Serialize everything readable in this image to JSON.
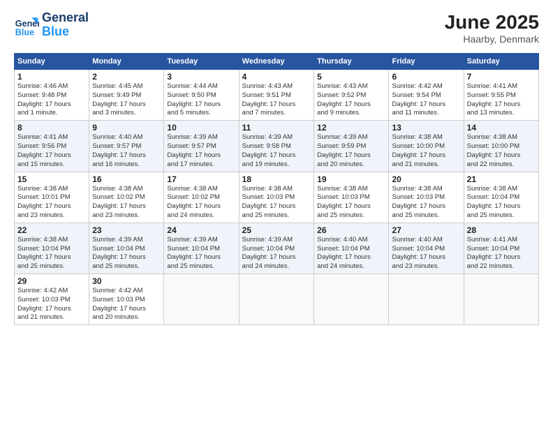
{
  "logo": {
    "line1": "General",
    "line2": "Blue"
  },
  "title": "June 2025",
  "location": "Haarby, Denmark",
  "headers": [
    "Sunday",
    "Monday",
    "Tuesday",
    "Wednesday",
    "Thursday",
    "Friday",
    "Saturday"
  ],
  "weeks": [
    [
      {
        "day": "1",
        "info": "Sunrise: 4:46 AM\nSunset: 9:48 PM\nDaylight: 17 hours\nand 1 minute."
      },
      {
        "day": "2",
        "info": "Sunrise: 4:45 AM\nSunset: 9:49 PM\nDaylight: 17 hours\nand 3 minutes."
      },
      {
        "day": "3",
        "info": "Sunrise: 4:44 AM\nSunset: 9:50 PM\nDaylight: 17 hours\nand 5 minutes."
      },
      {
        "day": "4",
        "info": "Sunrise: 4:43 AM\nSunset: 9:51 PM\nDaylight: 17 hours\nand 7 minutes."
      },
      {
        "day": "5",
        "info": "Sunrise: 4:43 AM\nSunset: 9:52 PM\nDaylight: 17 hours\nand 9 minutes."
      },
      {
        "day": "6",
        "info": "Sunrise: 4:42 AM\nSunset: 9:54 PM\nDaylight: 17 hours\nand 11 minutes."
      },
      {
        "day": "7",
        "info": "Sunrise: 4:41 AM\nSunset: 9:55 PM\nDaylight: 17 hours\nand 13 minutes."
      }
    ],
    [
      {
        "day": "8",
        "info": "Sunrise: 4:41 AM\nSunset: 9:56 PM\nDaylight: 17 hours\nand 15 minutes."
      },
      {
        "day": "9",
        "info": "Sunrise: 4:40 AM\nSunset: 9:57 PM\nDaylight: 17 hours\nand 16 minutes."
      },
      {
        "day": "10",
        "info": "Sunrise: 4:39 AM\nSunset: 9:57 PM\nDaylight: 17 hours\nand 17 minutes."
      },
      {
        "day": "11",
        "info": "Sunrise: 4:39 AM\nSunset: 9:58 PM\nDaylight: 17 hours\nand 19 minutes."
      },
      {
        "day": "12",
        "info": "Sunrise: 4:39 AM\nSunset: 9:59 PM\nDaylight: 17 hours\nand 20 minutes."
      },
      {
        "day": "13",
        "info": "Sunrise: 4:38 AM\nSunset: 10:00 PM\nDaylight: 17 hours\nand 21 minutes."
      },
      {
        "day": "14",
        "info": "Sunrise: 4:38 AM\nSunset: 10:00 PM\nDaylight: 17 hours\nand 22 minutes."
      }
    ],
    [
      {
        "day": "15",
        "info": "Sunrise: 4:38 AM\nSunset: 10:01 PM\nDaylight: 17 hours\nand 23 minutes."
      },
      {
        "day": "16",
        "info": "Sunrise: 4:38 AM\nSunset: 10:02 PM\nDaylight: 17 hours\nand 23 minutes."
      },
      {
        "day": "17",
        "info": "Sunrise: 4:38 AM\nSunset: 10:02 PM\nDaylight: 17 hours\nand 24 minutes."
      },
      {
        "day": "18",
        "info": "Sunrise: 4:38 AM\nSunset: 10:03 PM\nDaylight: 17 hours\nand 25 minutes."
      },
      {
        "day": "19",
        "info": "Sunrise: 4:38 AM\nSunset: 10:03 PM\nDaylight: 17 hours\nand 25 minutes."
      },
      {
        "day": "20",
        "info": "Sunrise: 4:38 AM\nSunset: 10:03 PM\nDaylight: 17 hours\nand 25 minutes."
      },
      {
        "day": "21",
        "info": "Sunrise: 4:38 AM\nSunset: 10:04 PM\nDaylight: 17 hours\nand 25 minutes."
      }
    ],
    [
      {
        "day": "22",
        "info": "Sunrise: 4:38 AM\nSunset: 10:04 PM\nDaylight: 17 hours\nand 25 minutes."
      },
      {
        "day": "23",
        "info": "Sunrise: 4:39 AM\nSunset: 10:04 PM\nDaylight: 17 hours\nand 25 minutes."
      },
      {
        "day": "24",
        "info": "Sunrise: 4:39 AM\nSunset: 10:04 PM\nDaylight: 17 hours\nand 25 minutes."
      },
      {
        "day": "25",
        "info": "Sunrise: 4:39 AM\nSunset: 10:04 PM\nDaylight: 17 hours\nand 24 minutes."
      },
      {
        "day": "26",
        "info": "Sunrise: 4:40 AM\nSunset: 10:04 PM\nDaylight: 17 hours\nand 24 minutes."
      },
      {
        "day": "27",
        "info": "Sunrise: 4:40 AM\nSunset: 10:04 PM\nDaylight: 17 hours\nand 23 minutes."
      },
      {
        "day": "28",
        "info": "Sunrise: 4:41 AM\nSunset: 10:04 PM\nDaylight: 17 hours\nand 22 minutes."
      }
    ],
    [
      {
        "day": "29",
        "info": "Sunrise: 4:42 AM\nSunset: 10:03 PM\nDaylight: 17 hours\nand 21 minutes."
      },
      {
        "day": "30",
        "info": "Sunrise: 4:42 AM\nSunset: 10:03 PM\nDaylight: 17 hours\nand 20 minutes."
      },
      null,
      null,
      null,
      null,
      null
    ]
  ]
}
